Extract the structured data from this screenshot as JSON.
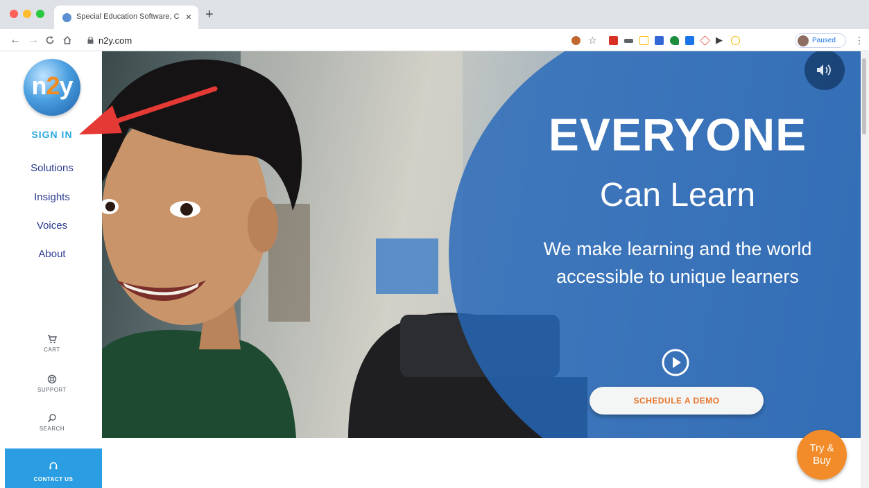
{
  "browser": {
    "tab_title": "Special Education Software, Cu",
    "tab_close": "×",
    "new_tab": "+",
    "url": "n2y.com",
    "profile_status": "Paused",
    "menu": "⋮"
  },
  "site": {
    "logo": {
      "part1": "n",
      "part2": "2",
      "part3": "y"
    },
    "sign_in": "SIGN IN",
    "nav": [
      "Solutions",
      "Insights",
      "Voices",
      "About"
    ],
    "utilities": {
      "cart": "CART",
      "support": "SUPPORT",
      "search": "SEARCH"
    },
    "contact": "CONTACT US"
  },
  "hero": {
    "headline": "EVERYONE",
    "subheadline": "Can Learn",
    "tagline_line1": "We make learning and the world",
    "tagline_line2": "accessible to unique learners",
    "cta": "SCHEDULE A DEMO"
  },
  "try_buy": {
    "line1": "Try &",
    "line2": "Buy"
  },
  "colors": {
    "accent_blue": "#29a6e0",
    "nav_blue": "#2a3a8f",
    "hero_blue": "#2668b9",
    "cta_orange": "#e8742a",
    "try_buy_orange": "#f28c2b",
    "arrow_red": "#e53935"
  }
}
